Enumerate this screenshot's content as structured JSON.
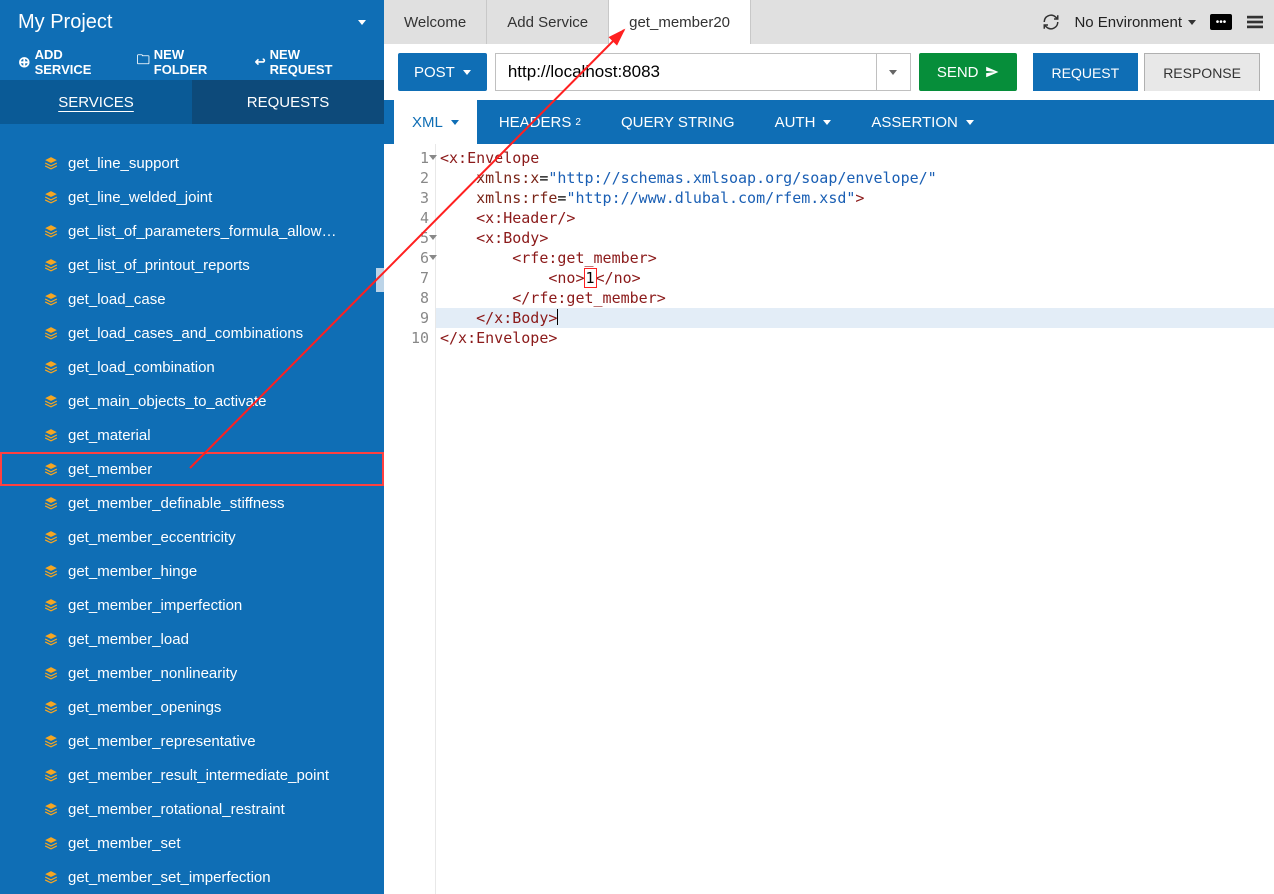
{
  "project": {
    "title": "My Project"
  },
  "sidebarActions": {
    "add_service": "ADD SERVICE",
    "new_folder": "NEW FOLDER",
    "new_request": "NEW REQUEST"
  },
  "sidebarTabs": {
    "services": "SERVICES",
    "requests": "REQUESTS"
  },
  "services": [
    "get_line_support",
    "get_line_welded_joint",
    "get_list_of_parameters_formula_allow…",
    "get_list_of_printout_reports",
    "get_load_case",
    "get_load_cases_and_combinations",
    "get_load_combination",
    "get_main_objects_to_activate",
    "get_material",
    "get_member",
    "get_member_definable_stiffness",
    "get_member_eccentricity",
    "get_member_hinge",
    "get_member_imperfection",
    "get_member_load",
    "get_member_nonlinearity",
    "get_member_openings",
    "get_member_representative",
    "get_member_result_intermediate_point",
    "get_member_rotational_restraint",
    "get_member_set",
    "get_member_set_imperfection"
  ],
  "highlightedServiceIndex": 9,
  "topTabs": [
    {
      "label": "Welcome",
      "active": false
    },
    {
      "label": "Add Service",
      "active": false
    },
    {
      "label": "get_member20",
      "active": true
    }
  ],
  "environment": {
    "label": "No Environment"
  },
  "request": {
    "method": "POST",
    "url": "http://localhost:8083",
    "send": "SEND"
  },
  "rrTabs": {
    "request": "REQUEST",
    "response": "RESPONSE"
  },
  "subTabs": {
    "xml": "XML",
    "headers": "HEADERS",
    "headersCount": "2",
    "query": "QUERY STRING",
    "auth": "AUTH",
    "assertion": "ASSERTION"
  },
  "code": {
    "lines": [
      {
        "n": 1,
        "fold": true,
        "indent": 0,
        "tokens": [
          [
            "tag",
            "<x:Envelope"
          ]
        ]
      },
      {
        "n": 2,
        "fold": false,
        "indent": 1,
        "tokens": [
          [
            "attr",
            "xmlns:x"
          ],
          [
            "txt",
            "="
          ],
          [
            "str",
            "\"http://schemas.xmlsoap.org/soap/envelope/\""
          ]
        ]
      },
      {
        "n": 3,
        "fold": false,
        "indent": 1,
        "tokens": [
          [
            "attr",
            "xmlns:rfe"
          ],
          [
            "txt",
            "="
          ],
          [
            "str",
            "\"http://www.dlubal.com/rfem.xsd\""
          ],
          [
            "tag",
            ">"
          ]
        ]
      },
      {
        "n": 4,
        "fold": false,
        "indent": 1,
        "tokens": [
          [
            "tag",
            "<x:Header/>"
          ]
        ]
      },
      {
        "n": 5,
        "fold": true,
        "indent": 1,
        "tokens": [
          [
            "tag",
            "<x:Body>"
          ]
        ]
      },
      {
        "n": 6,
        "fold": true,
        "indent": 2,
        "tokens": [
          [
            "tag",
            "<rfe:get_member>"
          ]
        ]
      },
      {
        "n": 7,
        "fold": false,
        "indent": 3,
        "tokens": [
          [
            "tag",
            "<no>"
          ],
          [
            "box",
            "1"
          ],
          [
            "tag",
            "</no>"
          ]
        ]
      },
      {
        "n": 8,
        "fold": false,
        "indent": 2,
        "tokens": [
          [
            "tag",
            "</rfe:get_member>"
          ]
        ]
      },
      {
        "n": 9,
        "fold": false,
        "indent": 1,
        "hl": true,
        "tokens": [
          [
            "tag",
            "</x:Body>"
          ],
          [
            "cursor",
            ""
          ]
        ]
      },
      {
        "n": 10,
        "fold": false,
        "indent": 0,
        "tokens": [
          [
            "tag",
            "</x:Envelope>"
          ]
        ]
      }
    ]
  }
}
